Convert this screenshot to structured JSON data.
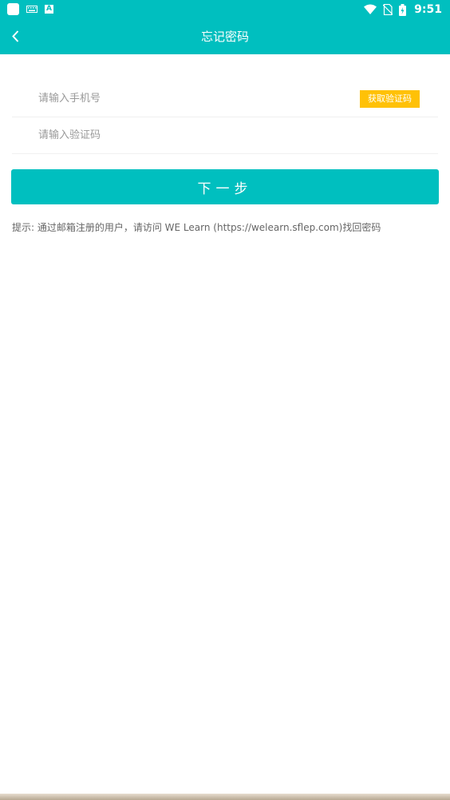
{
  "status_bar": {
    "time": "9:51",
    "left_icons": [
      "app-icon",
      "keyboard-icon",
      "a-icon"
    ],
    "right_icons": [
      "wifi-icon",
      "no-sim-icon",
      "battery-charging-icon"
    ]
  },
  "app_bar": {
    "title": "忘记密码",
    "back_icon": "chevron-left-icon",
    "color": "#00bfbf"
  },
  "form": {
    "phone_placeholder": "请输入手机号",
    "phone_value": "",
    "get_code_label": "获取验证码",
    "get_code_color": "#ffc107",
    "code_placeholder": "请输入验证码",
    "code_value": "",
    "next_label": "下一步"
  },
  "hint": "提示: 通过邮箱注册的用户，请访问 WE Learn (https://welearn.sflep.com)找回密码"
}
